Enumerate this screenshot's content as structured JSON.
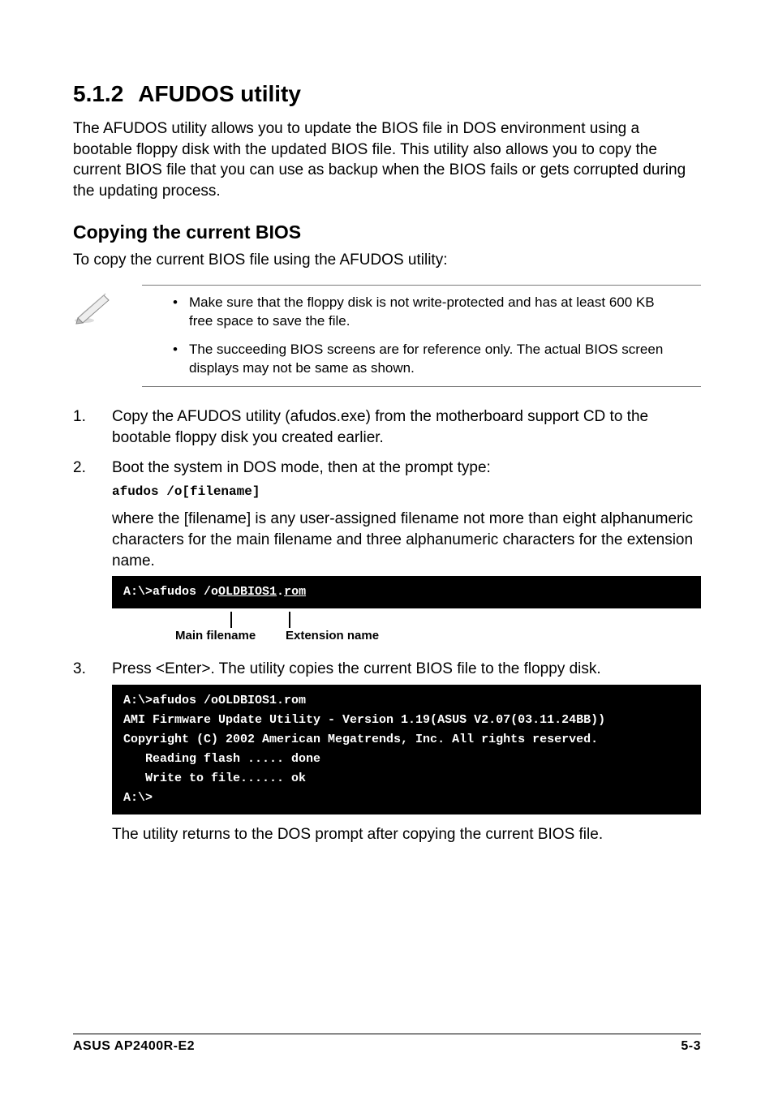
{
  "section_number": "5.1.2",
  "section_title": "AFUDOS utility",
  "section_body": "The AFUDOS utility allows you to update the BIOS file in DOS environment using a bootable floppy disk with the updated BIOS file. This utility also allows you to copy the current BIOS file that you can use as backup when the BIOS fails or gets corrupted during the updating process.",
  "subsection_title": "Copying the current BIOS",
  "subsection_body": "To copy the current BIOS file using the AFUDOS utility:",
  "notes": [
    "Make sure that the floppy disk is not write-protected and has at least 600 KB free space to save the file.",
    "The succeeding BIOS screens are for reference only. The actual BIOS screen displays may not be same as shown."
  ],
  "steps": {
    "s1_num": "1.",
    "s1_text": "Copy the AFUDOS utility (afudos.exe) from the motherboard support CD to the bootable floppy disk you created earlier.",
    "s2_num": "2.",
    "s2_text": "Boot the system in DOS mode, then at the prompt type:",
    "s2_cmd": "afudos /o[filename]",
    "s2_desc_a": "where the [filename] is any user-assigned filename not more than eight alphanumeric characters  for the main filename and three alphanumeric characters for the extension name.",
    "s3_num": "3.",
    "s3_text": "Press <Enter>. The utility copies the current BIOS file to the floppy disk.",
    "s3_after": "The utility returns to the DOS prompt after copying the current BIOS file."
  },
  "terminal1": {
    "prefix": "A:\\>afudos /o",
    "filename": "OLDBIOS1",
    "dot": ".",
    "ext": "rom"
  },
  "labels": {
    "main": "Main filename",
    "ext": "Extension name"
  },
  "terminal2_lines": {
    "l0": "A:\\>afudos /oOLDBIOS1.rom",
    "l1": "AMI Firmware Update Utility - Version 1.19(ASUS V2.07(03.11.24BB))",
    "l2": "Copyright (C) 2002 American Megatrends, Inc. All rights reserved.",
    "l3": "   Reading flash ..... done",
    "l4": "   Write to file...... ok",
    "l5": "A:\\>"
  },
  "footer": {
    "left": "ASUS AP2400R-E2",
    "right": "5-3"
  }
}
